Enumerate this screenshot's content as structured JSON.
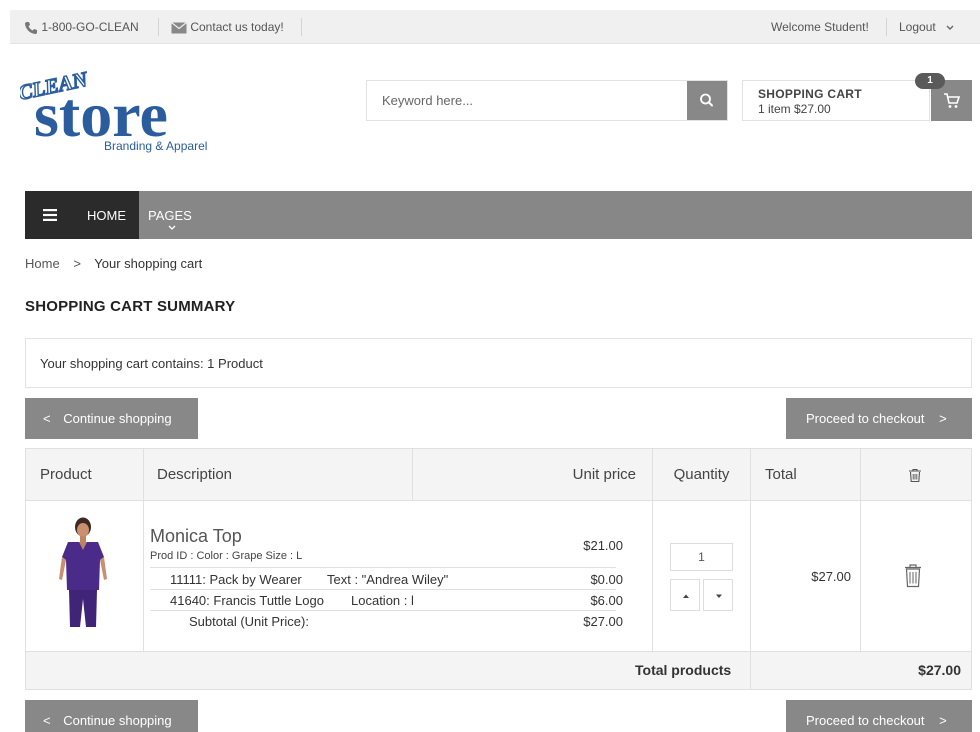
{
  "topbar": {
    "phone": "1-800-GO-CLEAN",
    "contact": "Contact us today!",
    "welcome": "Welcome Student!",
    "logout": "Logout"
  },
  "logo": {
    "script_text": "CLEAN",
    "main_text": "store",
    "tagline": "Branding & Apparel"
  },
  "search": {
    "placeholder": "Keyword here..."
  },
  "cart": {
    "title": "SHOPPING CART",
    "summary": "1 item $27.00",
    "badge": "1"
  },
  "nav": {
    "home": "HOME",
    "pages": "PAGES"
  },
  "breadcrumb": {
    "home": "Home",
    "separator": ">",
    "current": "Your shopping cart"
  },
  "page_title": "SHOPPING CART SUMMARY",
  "notice": "Your shopping cart contains: 1 Product",
  "buttons": {
    "continue_icon": "<",
    "continue": "Continue shopping",
    "checkout": "Proceed to checkout",
    "checkout_icon": ">"
  },
  "table": {
    "headers": [
      "Product",
      "Description",
      "Unit price",
      "Quantity",
      "Total"
    ],
    "item": {
      "name": "Monica Top",
      "meta": "Prod ID : Color : Grape Size : L",
      "base_price": "$21.00",
      "options": [
        {
          "label": "11111: Pack by Wearer",
          "detail": "Text : \"Andrea Wiley\"",
          "price": "$0.00"
        },
        {
          "label": "41640: Francis Tuttle Logo",
          "detail": "Location : l",
          "price": "$6.00"
        }
      ],
      "subtotal_label": "Subtotal (Unit Price):",
      "subtotal": "$27.00",
      "quantity": "1",
      "total": "$27.00"
    },
    "footer": {
      "label": "Total products",
      "value": "$27.00"
    }
  },
  "colors": {
    "button_gray": "#888888",
    "nav_dark": "#2b2b2b",
    "logo_blue": "#2a5c9e",
    "garment_purple": "#4b2b8a"
  }
}
